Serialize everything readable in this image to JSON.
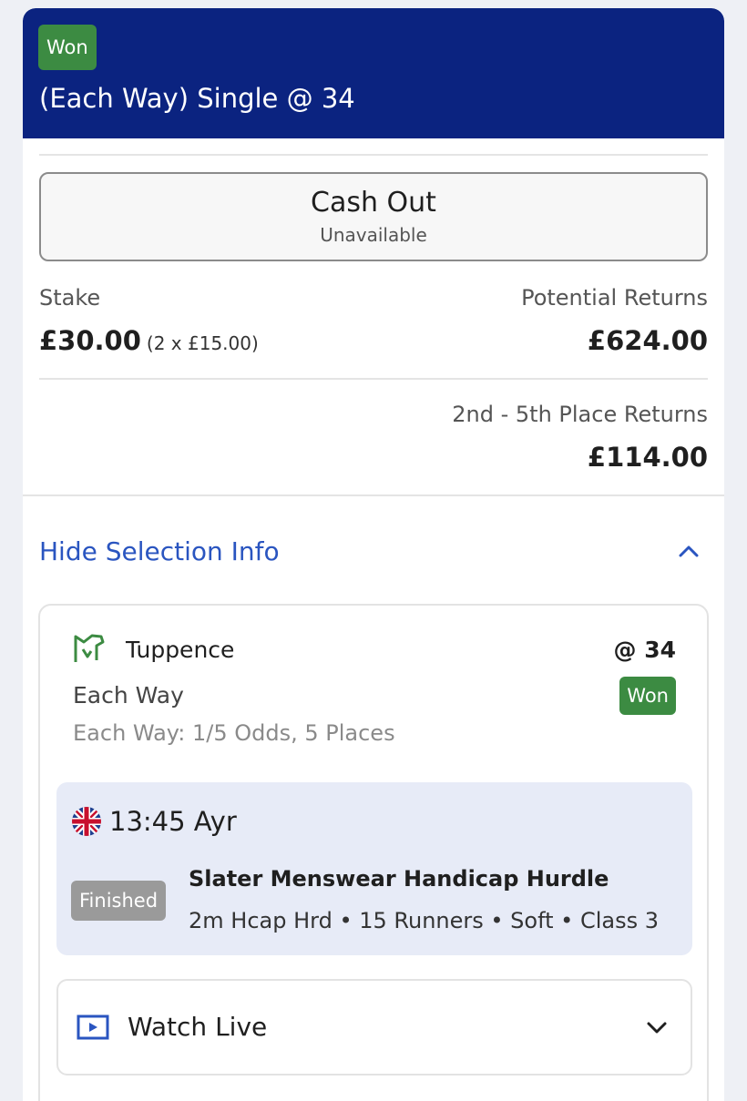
{
  "header": {
    "status_badge": "Won",
    "bet_title": "(Each Way) Single @ 34"
  },
  "cash_out": {
    "label": "Cash Out",
    "status": "Unavailable"
  },
  "stake": {
    "label": "Stake",
    "amount": "£30.00",
    "breakdown": "(2 x £15.00)"
  },
  "returns": {
    "potential_label": "Potential Returns",
    "potential_amount": "£624.00",
    "place_label": "2nd - 5th Place Returns",
    "place_amount": "£114.00"
  },
  "selection_toggle": {
    "label": "Hide Selection Info"
  },
  "selection": {
    "horse": "Tuppence",
    "odds": "@ 34",
    "bet_type": "Each Way",
    "result_badge": "Won",
    "each_way_terms": "Each Way: 1/5 Odds, 5 Places"
  },
  "race": {
    "time_course": "13:45 Ayr",
    "status": "Finished",
    "name": "Slater Menswear Handicap Hurdle",
    "details": "2m Hcap Hrd • 15 Runners • Soft • Class 3"
  },
  "watch_live": {
    "label": "Watch Live"
  },
  "colors": {
    "header_bg": "#0b2380",
    "won_green": "#3c8b42",
    "link_blue": "#2a55c0",
    "race_bg": "#e7ebf7"
  },
  "icons": [
    "horse-racing-icon",
    "chevron-up-icon",
    "uk-flag-icon",
    "play-icon",
    "chevron-down-icon"
  ]
}
